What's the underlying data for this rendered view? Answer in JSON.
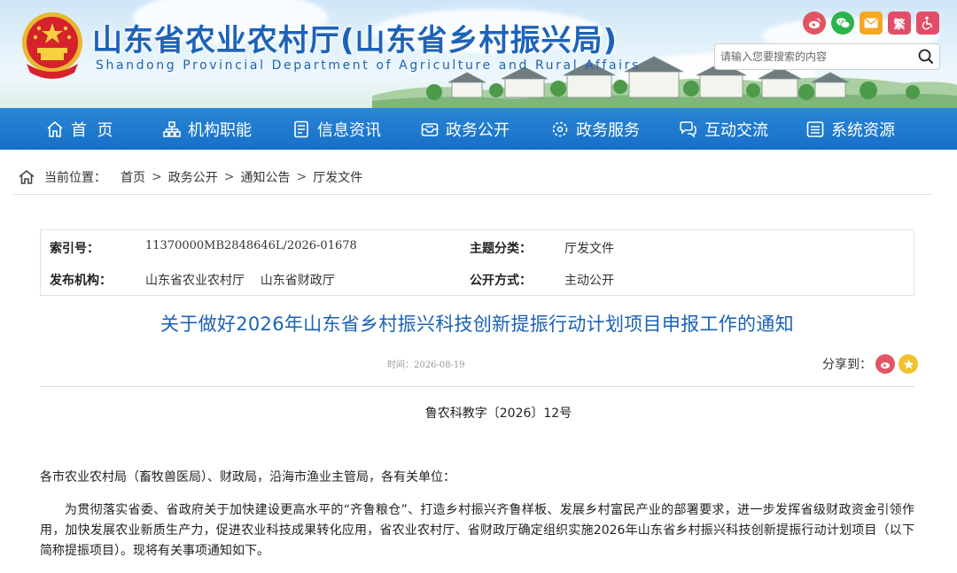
{
  "header": {
    "title": "山东省农业农村厅(山东省乡村振兴局)",
    "subtitle": "Shandong Provincial Department of Agriculture and Rural Affairs",
    "top_icons": [
      {
        "name": "weibo-icon",
        "glyph": "",
        "color": "#e05561"
      },
      {
        "name": "wechat-icon",
        "glyph": "",
        "color": "#2ab44b"
      },
      {
        "name": "mail-icon",
        "glyph": "",
        "color": "#f5a623"
      },
      {
        "name": "traditional-chinese-icon",
        "glyph": "繁",
        "color": "#e24e6a"
      },
      {
        "name": "accessibility-icon",
        "glyph": "",
        "color": "#e24e6a"
      }
    ],
    "search": {
      "placeholder": "请输入您要搜索的内容"
    }
  },
  "nav": {
    "items": [
      {
        "label": "首  页",
        "icon": "home-icon"
      },
      {
        "label": "机构职能",
        "icon": "org-structure-icon"
      },
      {
        "label": "信息资讯",
        "icon": "document-list-icon"
      },
      {
        "label": "政务公开",
        "icon": "inbox-icon"
      },
      {
        "label": "政务服务",
        "icon": "service-icon"
      },
      {
        "label": "互动交流",
        "icon": "chat-icon"
      },
      {
        "label": "系统资源",
        "icon": "list-icon"
      }
    ]
  },
  "breadcrumb": {
    "label": "当前位置：",
    "items": [
      "首页",
      "政务公开",
      "通知公告",
      "厅发文件"
    ],
    "separator": ">"
  },
  "meta": {
    "index_label": "索引号：",
    "index_value": "11370000MB2848646L/2026-01678",
    "category_label": "主题分类：",
    "category_value": "厅发文件",
    "issuer_label": "发布机构：",
    "issuer_value": "山东省农业农村厅    山东省财政厅",
    "disclosure_label": "公开方式：",
    "disclosure_value": "主动公开"
  },
  "article": {
    "title": "关于做好2026年山东省乡村振兴科技创新提振行动计划项目申报工作的通知",
    "time": "时间：2026-08-19",
    "share_label": "分享到：",
    "doc_number": "鲁农科教字〔2026〕12号",
    "salutation": "各市农业农村局（畜牧兽医局）、财政局，沿海市渔业主管局，各有关单位：",
    "paragraph": "为贯彻落实省委、省政府关于加快建设更高水平的“齐鲁粮仓”、打造乡村振兴齐鲁样板、发展乡村富民产业的部署要求，进一步发挥省级财政资金引领作用，加快发展农业新质生产力，促进农业科技成果转化应用，省农业农村厅、省财政厅确定组织实施2026年山东省乡村振兴科技创新提振行动计划项目（以下简称提振项目）。现将有关事项通知如下。"
  },
  "colors": {
    "brand_blue": "#1d63b7",
    "nav_blue": "#1670c6",
    "title_blue": "#1b62b5",
    "weibo_red": "#e05561",
    "star_yellow": "#f2c12e"
  }
}
